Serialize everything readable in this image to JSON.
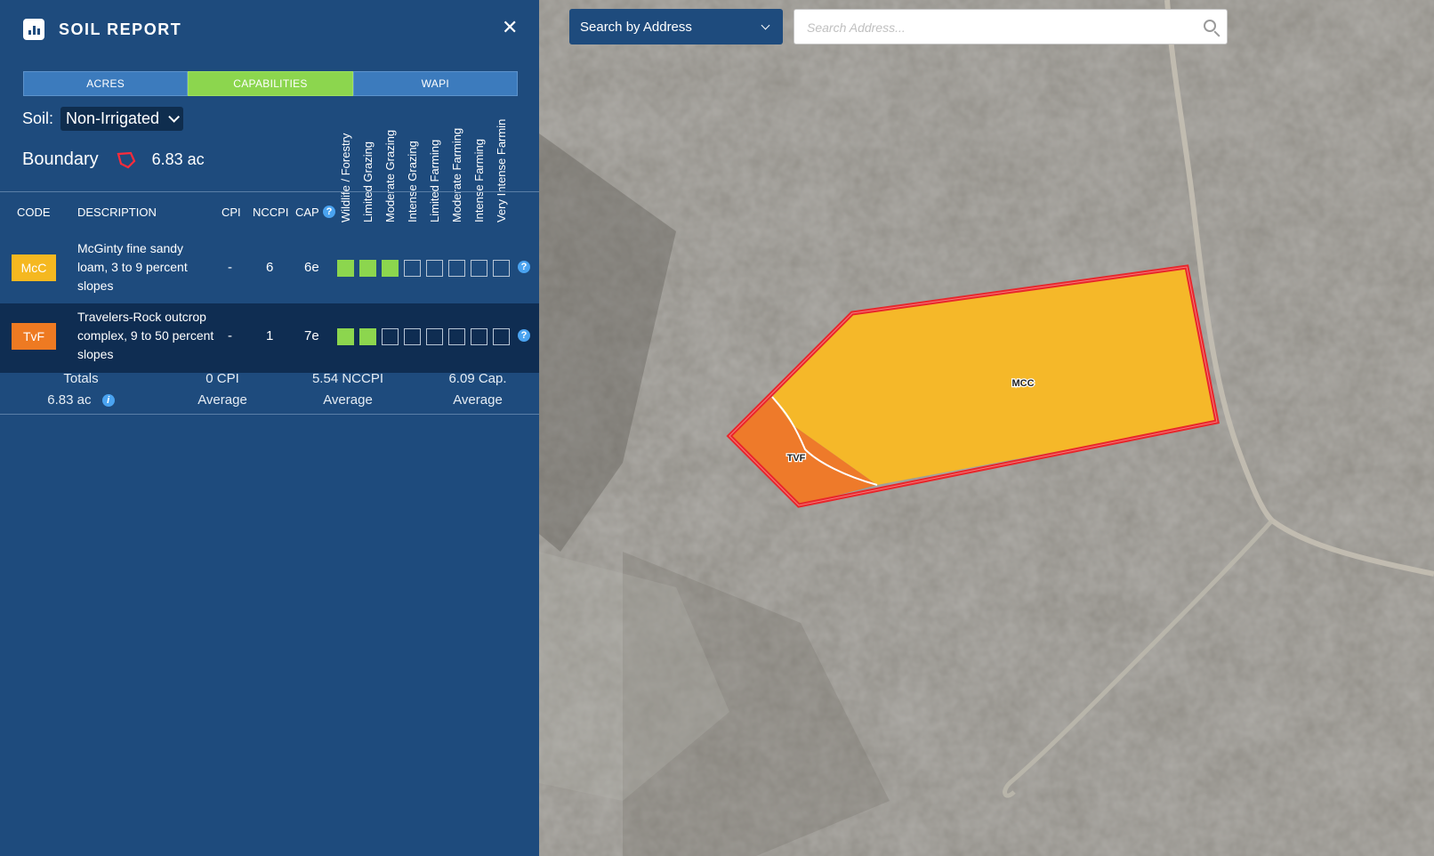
{
  "panel": {
    "title": "SOIL REPORT",
    "tabs": [
      {
        "label": "ACRES",
        "active": false
      },
      {
        "label": "CAPABILITIES",
        "active": true
      },
      {
        "label": "WAPI",
        "active": false
      }
    ],
    "soil_label": "Soil:",
    "soil_value": "Non-Irrigated",
    "boundary_label": "Boundary",
    "boundary_acres": "6.83 ac",
    "capability_headers": [
      "Wildlife / Forestry",
      "Limited Grazing",
      "Moderate Grazing",
      "Intense Grazing",
      "Limited Farming",
      "Moderate Farming",
      "Intense Farming",
      "Very Intense Farmin"
    ],
    "columns": {
      "code": "CODE",
      "description": "DESCRIPTION",
      "cpi": "CPI",
      "nccpi": "NCCPI",
      "cap": "CAP"
    },
    "rows": [
      {
        "code": "McC",
        "color": "#f5b820",
        "description": "McGinty fine sandy loam, 3 to 9 percent slopes",
        "cpi": "-",
        "nccpi": "6",
        "cap": "6e",
        "capabilities_filled": 3
      },
      {
        "code": "TvF",
        "color": "#ee7a22",
        "description": "Travelers-Rock outcrop complex, 9 to 50 percent slopes",
        "cpi": "-",
        "nccpi": "1",
        "cap": "7e",
        "capabilities_filled": 2
      }
    ],
    "totals": {
      "label": "Totals",
      "acres": "6.83 ac",
      "cpi_value": "0 CPI",
      "cpi_sub": "Average",
      "nccpi_value": "5.54 NCCPI",
      "nccpi_sub": "Average",
      "cap_value": "6.09 Cap.",
      "cap_sub": "Average"
    }
  },
  "search": {
    "mode": "Search by Address",
    "placeholder": "Search Address..."
  },
  "map": {
    "polygon_labels": {
      "mcc": "MCC",
      "tvf": "TVF"
    }
  }
}
